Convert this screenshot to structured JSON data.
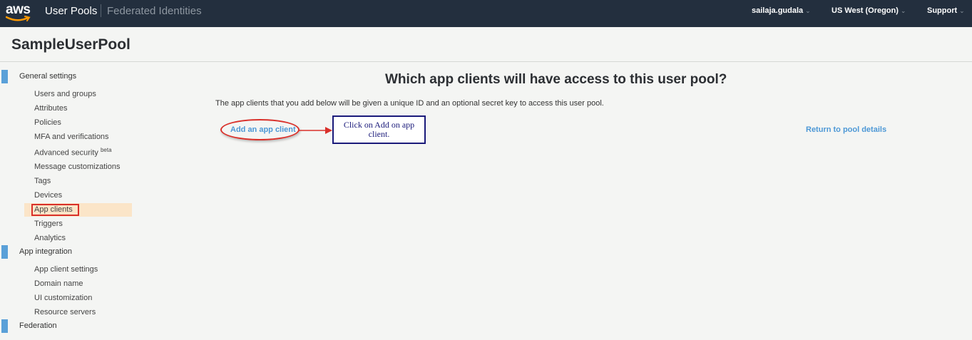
{
  "header": {
    "logo_text": "aws",
    "nav_user_pools": "User Pools",
    "nav_federated": "Federated Identities",
    "user": "sailaja.gudala",
    "region": "US West (Oregon)",
    "support": "Support"
  },
  "page": {
    "title": "SampleUserPool"
  },
  "sidebar": {
    "sections": [
      {
        "label": "General settings",
        "items": [
          "Users and groups",
          "Attributes",
          "Policies",
          "MFA and verifications",
          "Advanced security",
          "Message customizations",
          "Tags",
          "Devices",
          "App clients",
          "Triggers",
          "Analytics"
        ]
      },
      {
        "label": "App integration",
        "items": [
          "App client settings",
          "Domain name",
          "UI customization",
          "Resource servers"
        ]
      },
      {
        "label": "Federation",
        "items": []
      }
    ],
    "beta_badge": "beta",
    "active_item": "App clients"
  },
  "main": {
    "heading": "Which app clients will have access to this user pool?",
    "description": "The app clients that you add below will be given a unique ID and an optional secret key to access this user pool.",
    "add_link": "Add an app client",
    "return_link": "Return to pool details",
    "callout_text": "Click on Add on app client."
  },
  "colors": {
    "topbar": "#232f3e",
    "accent_bar": "#5aa0d8",
    "link": "#4d98d6",
    "active_bg": "#fbe5c8",
    "annotation_red": "#d9302a",
    "callout_border": "#1a1a7a"
  }
}
